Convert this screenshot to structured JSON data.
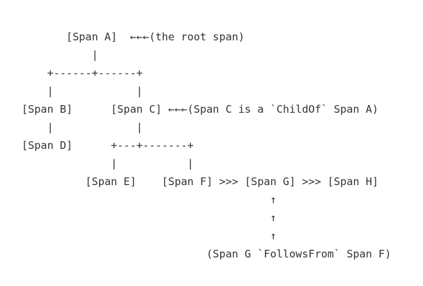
{
  "diagram": {
    "lines": [
      "       [Span A]  ←←←(the root span)",
      "           |",
      "    +------+------+",
      "    |             |",
      "[Span B]      [Span C] ←←←(Span C is a `ChildOf` Span A)",
      "    |             |",
      "[Span D]      +---+-------+",
      "              |           |",
      "          [Span E]    [Span F] >>> [Span G] >>> [Span H]",
      "                                       ↑",
      "                                       ↑",
      "                                       ↑",
      "                             (Span G `FollowsFrom` Span F)"
    ]
  }
}
